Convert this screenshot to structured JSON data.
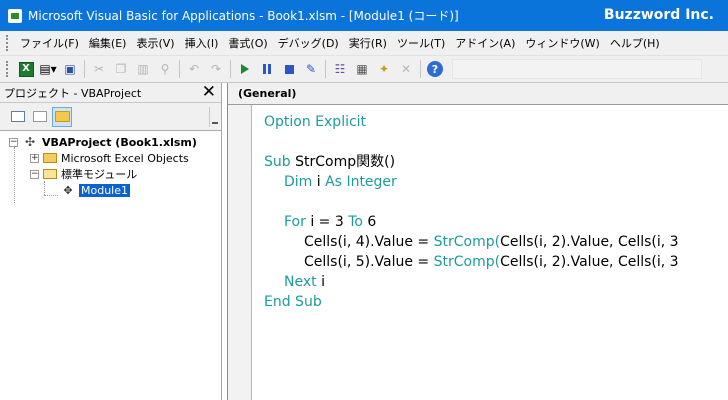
{
  "window": {
    "title": "Microsoft Visual Basic for Applications - Book1.xlsm - [Module1 (コード)]",
    "brand": "Buzzword Inc."
  },
  "menu": [
    "ファイル(F)",
    "編集(E)",
    "表示(V)",
    "挿入(I)",
    "書式(O)",
    "デバッグ(D)",
    "実行(R)",
    "ツール(T)",
    "アドイン(A)",
    "ウィンドウ(W)",
    "ヘルプ(H)"
  ],
  "toolbar": {
    "icons": [
      "excel-view-icon",
      "insert-module-icon",
      "save-icon",
      "cut-icon",
      "copy-icon",
      "paste-icon",
      "find-icon",
      "undo-icon",
      "redo-icon",
      "run-icon",
      "break-icon",
      "reset-icon",
      "design-mode-icon",
      "project-explorer-icon",
      "properties-icon",
      "object-browser-icon",
      "toolbox-icon",
      "help-icon"
    ]
  },
  "project_pane": {
    "title": "プロジェクト - VBAProject",
    "close_glyph": "✕",
    "tree": {
      "root": "VBAProject (Book1.xlsm)",
      "excel_objects": "Microsoft Excel Objects",
      "standard_modules": "標準モジュール",
      "module": "Module1"
    }
  },
  "code_pane": {
    "object_combo": "(General)",
    "lines": [
      {
        "indent": 0,
        "parts": [
          {
            "t": "Option Explicit",
            "k": true
          }
        ]
      },
      {
        "indent": 0,
        "parts": []
      },
      {
        "indent": 0,
        "parts": [
          {
            "t": "Sub",
            "k": true
          },
          {
            "t": " StrComp関数()",
            "k": false
          }
        ]
      },
      {
        "indent": 1,
        "parts": [
          {
            "t": "Dim",
            "k": true
          },
          {
            "t": " i ",
            "k": false
          },
          {
            "t": "As",
            "k": true
          },
          {
            "t": " ",
            "k": false
          },
          {
            "t": "Integer",
            "k": true
          }
        ]
      },
      {
        "indent": 0,
        "parts": []
      },
      {
        "indent": 1,
        "parts": [
          {
            "t": "For",
            "k": true
          },
          {
            "t": " i = 3 ",
            "k": false
          },
          {
            "t": "To",
            "k": true
          },
          {
            "t": " 6",
            "k": false
          }
        ]
      },
      {
        "indent": 2,
        "parts": [
          {
            "t": "Cells(i, 4).Value = ",
            "k": false
          },
          {
            "t": "StrComp(",
            "k": true
          },
          {
            "t": "Cells(i, 2).Value, Cells(i, 3",
            "k": false
          }
        ]
      },
      {
        "indent": 2,
        "parts": [
          {
            "t": "Cells(i, 5).Value = ",
            "k": false
          },
          {
            "t": "StrComp(",
            "k": true
          },
          {
            "t": "Cells(i, 2).Value, Cells(i, 3",
            "k": false
          }
        ]
      },
      {
        "indent": 1,
        "parts": [
          {
            "t": "Next",
            "k": true
          },
          {
            "t": " i",
            "k": false
          }
        ]
      },
      {
        "indent": 0,
        "parts": [
          {
            "t": "End Sub",
            "k": true
          }
        ]
      }
    ]
  }
}
